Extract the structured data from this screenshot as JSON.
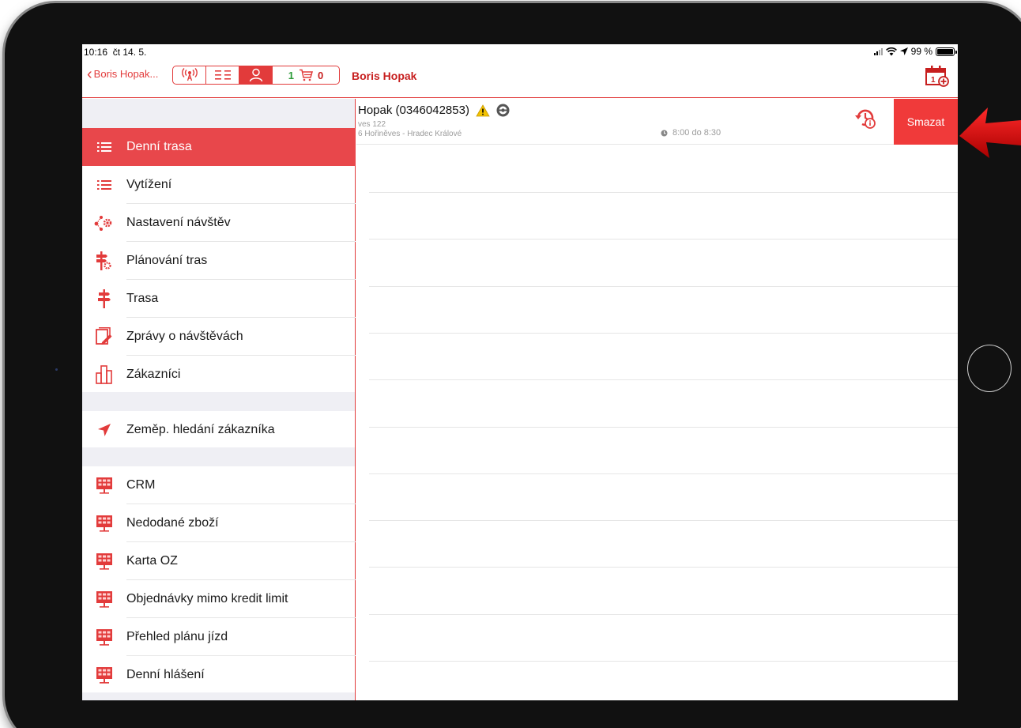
{
  "status": {
    "time": "10:16",
    "date": "čt 14. 5.",
    "battery": "99 %"
  },
  "nav": {
    "back_label": "Boris Hopak...",
    "cart_count_green": "1",
    "cart_count": "0",
    "title": "Boris Hopak"
  },
  "sidebar": {
    "items": [
      {
        "label": "Denní trasa",
        "icon": "list-icon",
        "active": true
      },
      {
        "label": "Vytížení",
        "icon": "list-icon"
      },
      {
        "label": "Nastavení návštěv",
        "icon": "route-settings-icon"
      },
      {
        "label": "Plánování tras",
        "icon": "signpost-gear-icon"
      },
      {
        "label": "Trasa",
        "icon": "signpost-icon"
      },
      {
        "label": "Zprávy o návštěvách",
        "icon": "report-edit-icon"
      },
      {
        "label": "Zákazníci",
        "icon": "customers-icon"
      }
    ],
    "geo_item": {
      "label": "Zeměp. hledání zákazníka",
      "icon": "location-arrow-icon"
    },
    "reports": [
      {
        "label": "CRM"
      },
      {
        "label": "Nedodané zboží"
      },
      {
        "label": "Karta OZ"
      },
      {
        "label": "Objednávky mimo kredit limit"
      },
      {
        "label": "Přehled plánu jízd"
      },
      {
        "label": "Denní hlášení"
      }
    ]
  },
  "visit": {
    "name": "Hopak (0346042853)",
    "address1": "ves 122",
    "address2": "6 Hořiněves - Hradec Králové",
    "time": "8:00 do 8:30",
    "delete_label": "Smazat"
  },
  "colors": {
    "accent": "#e23b3b",
    "active_bg": "#e8474b",
    "delete_bg": "#f03a3a",
    "arrow": "#d40000"
  }
}
